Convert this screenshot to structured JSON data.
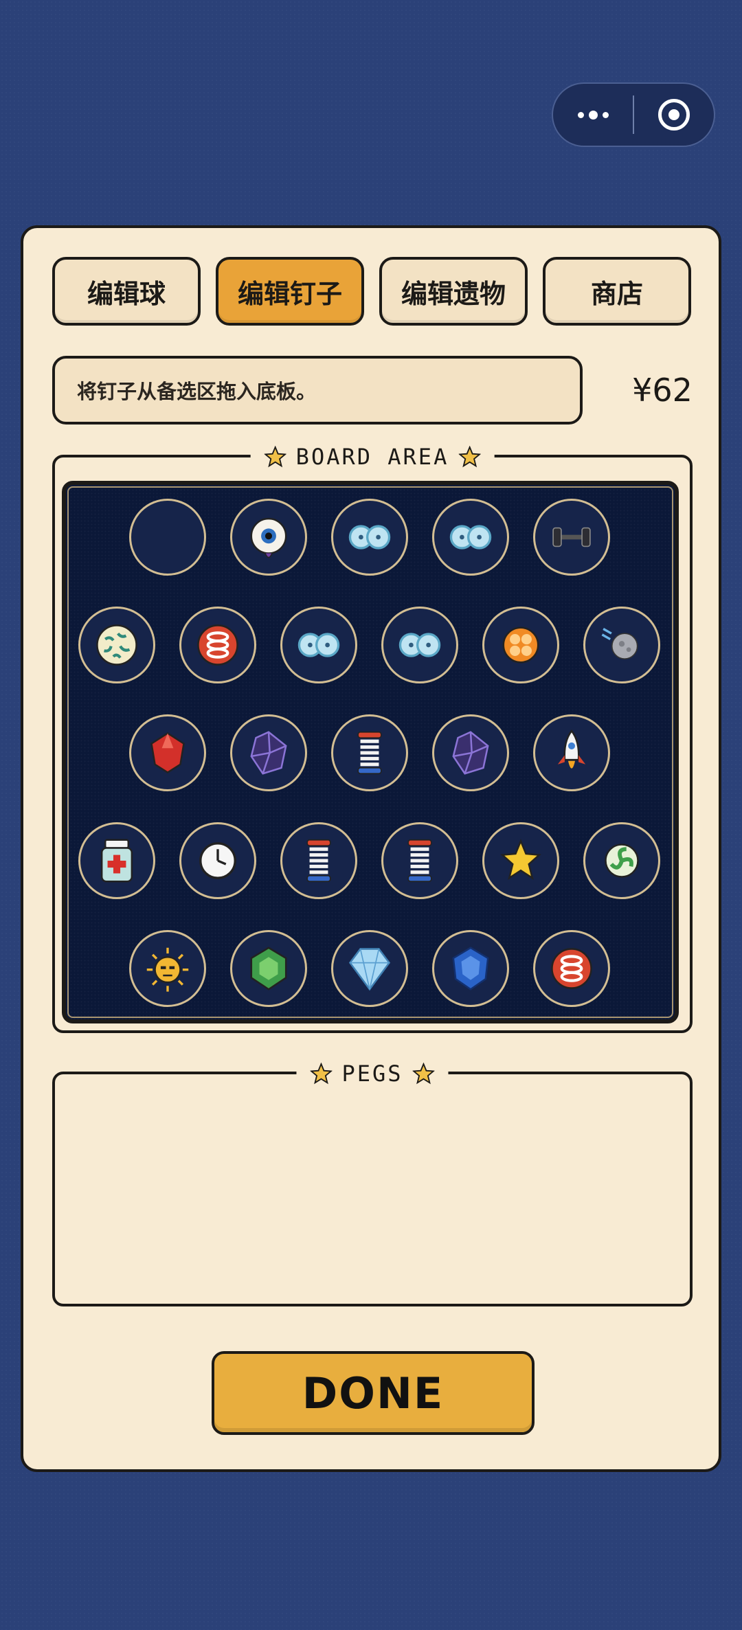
{
  "capsule": {
    "more_icon": "more-dots-icon",
    "close_icon": "target-circle-icon"
  },
  "tabs": [
    {
      "label": "编辑球",
      "active": false
    },
    {
      "label": "编辑钉子",
      "active": true
    },
    {
      "label": "编辑遗物",
      "active": false
    },
    {
      "label": "商店",
      "active": false
    }
  ],
  "hint": "将钉子从备选区拖入底板。",
  "money": "¥62",
  "board_area": {
    "title": "BOARD AREA",
    "rows": [
      [
        "empty",
        "eyeball",
        "twin-bubble",
        "twin-bubble",
        "dumbbell"
      ],
      [
        "coral-pattern",
        "red-spring-coil",
        "twin-bubble",
        "twin-bubble",
        "orange-clover",
        "moon"
      ],
      [
        "red-gem",
        "purple-crystal",
        "spring-stack",
        "purple-crystal",
        "rocket"
      ],
      [
        "medicine-bottle",
        "clock",
        "spring-stack",
        "spring-stack",
        "star",
        "green-swirl"
      ],
      [
        "sun-face",
        "green-gem",
        "blue-diamond",
        "blue-sapphire",
        "red-spring-coil"
      ]
    ]
  },
  "pegs_area": {
    "title": "PEGS"
  },
  "done_label": "DONE",
  "colors": {
    "background": "#2b4178",
    "panel": "#f8ebd3",
    "active_tab": "#e9a338",
    "board": "#0b1838",
    "done": "#e8ae3e"
  }
}
